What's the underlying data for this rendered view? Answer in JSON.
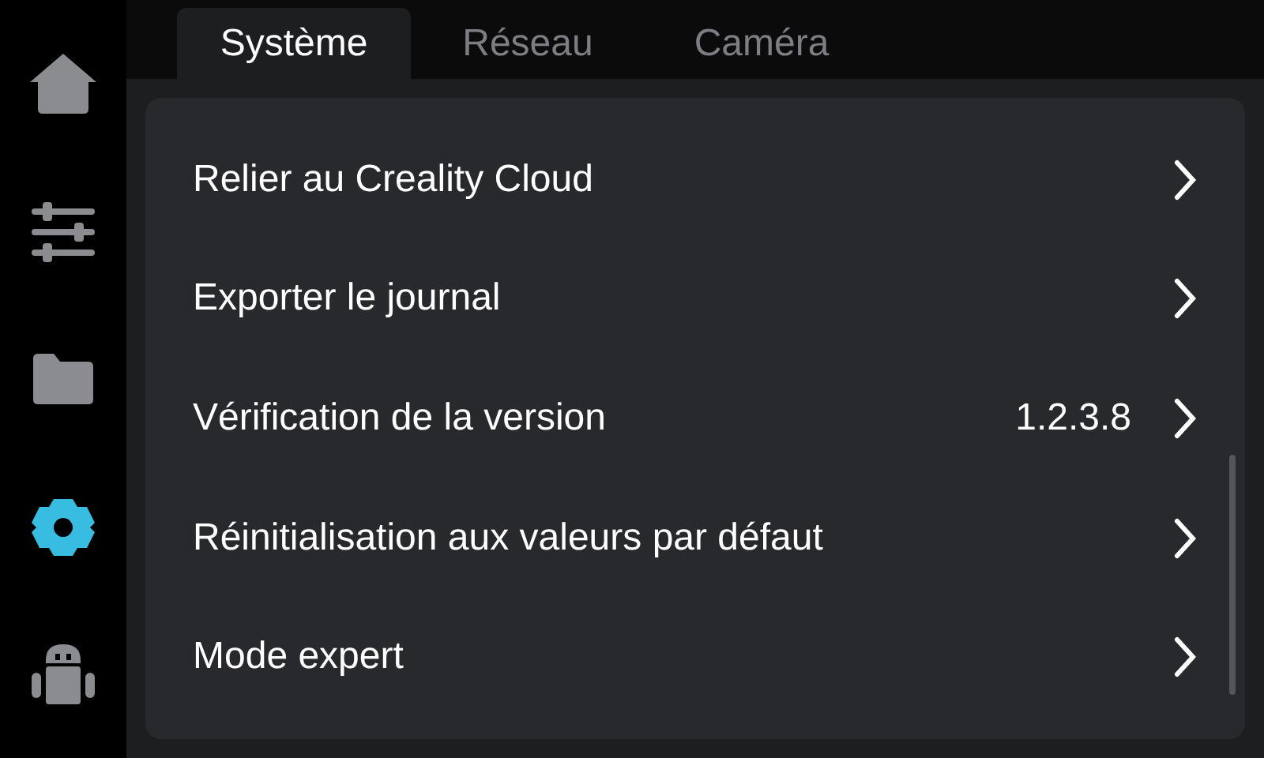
{
  "sidebar": {
    "items": [
      {
        "kind": "home",
        "selected": false
      },
      {
        "kind": "sliders",
        "selected": false
      },
      {
        "kind": "folder",
        "selected": false
      },
      {
        "kind": "settings",
        "selected": true
      },
      {
        "kind": "robot",
        "selected": false
      }
    ]
  },
  "tabs": [
    {
      "label": "Système",
      "selected": true
    },
    {
      "label": "Réseau",
      "selected": false
    },
    {
      "label": "Caméra",
      "selected": false
    }
  ],
  "settings": [
    {
      "label": "Relier au Creality Cloud"
    },
    {
      "label": "Exporter le journal"
    },
    {
      "label": "Vérification de la version",
      "value": "1.2.3.8"
    },
    {
      "label": "Réinitialisation aux valeurs par défaut"
    },
    {
      "label": "Mode expert"
    }
  ]
}
